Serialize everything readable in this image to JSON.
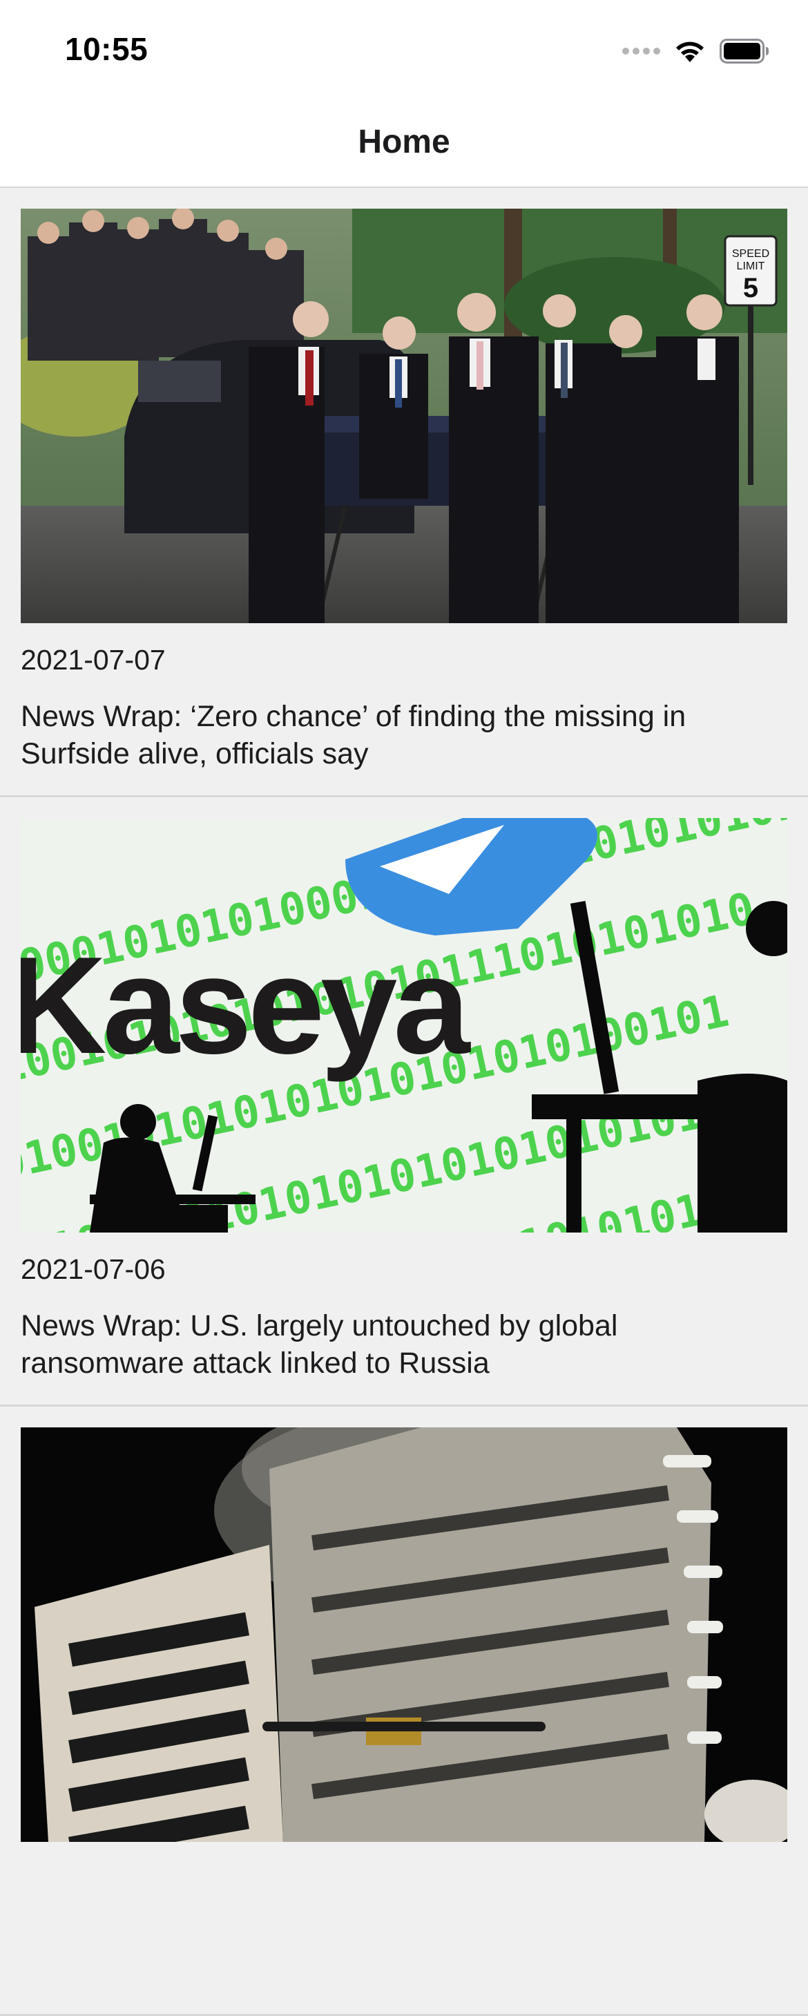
{
  "status_bar": {
    "time": "10:55",
    "icons": [
      "cellular-signal-icon",
      "wifi-icon",
      "battery-icon"
    ]
  },
  "nav": {
    "title": "Home"
  },
  "articles": [
    {
      "date": "2021-07-07",
      "title": "News Wrap: ‘Zero chance’ of finding the missing in Surfside alive, officials say",
      "image": "funeral-procession-photo"
    },
    {
      "date": "2021-07-06",
      "title": "News Wrap: U.S. largely untouched by global ransomware attack linked to Russia",
      "image": "kaseya-logo-binary-photo",
      "image_text": "Kaseya"
    },
    {
      "date": "",
      "title": "",
      "image": "building-demolition-photo"
    }
  ],
  "colors": {
    "background": "#f0f0f0",
    "bar_background": "#ffffff",
    "text": "#1c1c1e",
    "divider": "#d7d7d9"
  }
}
